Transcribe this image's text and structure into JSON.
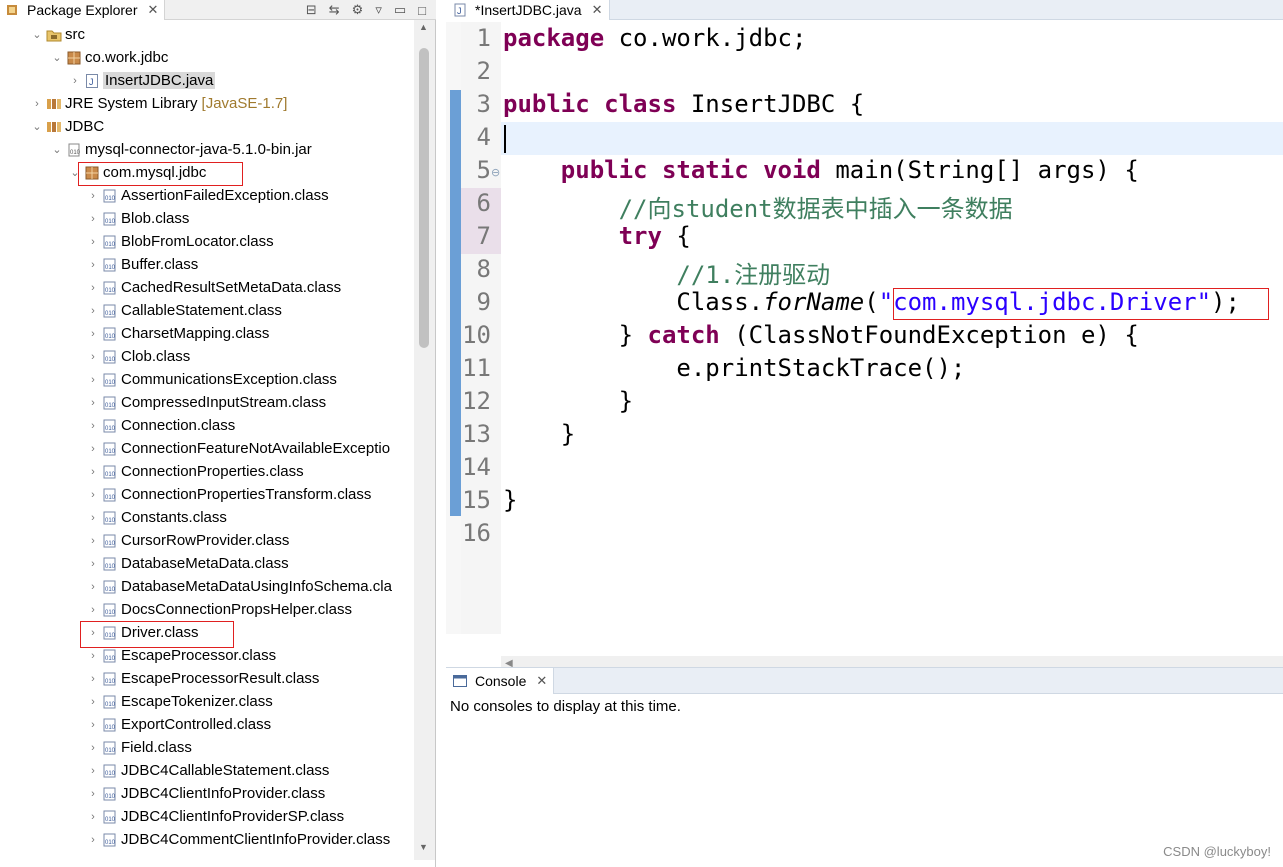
{
  "package_explorer": {
    "tab_label": "Package Explorer",
    "tree": [
      {
        "label": "src",
        "icon": "source-folder-icon",
        "arrow": "expanded"
      },
      {
        "label": "co.work.jdbc",
        "icon": "package-icon",
        "arrow": "expanded"
      },
      {
        "label": "InsertJDBC.java",
        "icon": "java-file-icon",
        "arrow": "collapsed"
      },
      {
        "label": "JRE System Library",
        "suffix": "[JavaSE-1.7]",
        "icon": "library-icon",
        "arrow": "collapsed"
      },
      {
        "label": "JDBC",
        "icon": "library-icon",
        "arrow": "expanded"
      },
      {
        "label": "mysql-connector-java-5.1.0-bin.jar",
        "icon": "jar-icon",
        "arrow": "expanded"
      },
      {
        "label": "com.mysql.jdbc",
        "icon": "package-icon",
        "arrow": "expanded"
      },
      {
        "label": "AssertionFailedException.class",
        "icon": "class-file-icon",
        "arrow": "collapsed"
      },
      {
        "label": "Blob.class",
        "icon": "class-file-icon",
        "arrow": "collapsed"
      },
      {
        "label": "BlobFromLocator.class",
        "icon": "class-file-icon",
        "arrow": "collapsed"
      },
      {
        "label": "Buffer.class",
        "icon": "class-file-icon",
        "arrow": "collapsed"
      },
      {
        "label": "CachedResultSetMetaData.class",
        "icon": "class-file-icon",
        "arrow": "collapsed"
      },
      {
        "label": "CallableStatement.class",
        "icon": "class-file-icon",
        "arrow": "collapsed"
      },
      {
        "label": "CharsetMapping.class",
        "icon": "class-file-icon",
        "arrow": "collapsed"
      },
      {
        "label": "Clob.class",
        "icon": "class-file-icon",
        "arrow": "collapsed"
      },
      {
        "label": "CommunicationsException.class",
        "icon": "class-file-icon",
        "arrow": "collapsed"
      },
      {
        "label": "CompressedInputStream.class",
        "icon": "class-file-icon",
        "arrow": "collapsed"
      },
      {
        "label": "Connection.class",
        "icon": "class-file-icon",
        "arrow": "collapsed"
      },
      {
        "label": "ConnectionFeatureNotAvailableExceptio",
        "icon": "class-file-icon",
        "arrow": "collapsed"
      },
      {
        "label": "ConnectionProperties.class",
        "icon": "class-file-icon",
        "arrow": "collapsed"
      },
      {
        "label": "ConnectionPropertiesTransform.class",
        "icon": "class-file-icon",
        "arrow": "collapsed"
      },
      {
        "label": "Constants.class",
        "icon": "class-file-icon",
        "arrow": "collapsed"
      },
      {
        "label": "CursorRowProvider.class",
        "icon": "class-file-icon",
        "arrow": "collapsed"
      },
      {
        "label": "DatabaseMetaData.class",
        "icon": "class-file-icon",
        "arrow": "collapsed"
      },
      {
        "label": "DatabaseMetaDataUsingInfoSchema.cla",
        "icon": "class-file-icon",
        "arrow": "collapsed"
      },
      {
        "label": "DocsConnectionPropsHelper.class",
        "icon": "class-file-icon",
        "arrow": "collapsed"
      },
      {
        "label": "Driver.class",
        "icon": "class-file-icon",
        "arrow": "collapsed"
      },
      {
        "label": "EscapeProcessor.class",
        "icon": "class-file-icon",
        "arrow": "collapsed"
      },
      {
        "label": "EscapeProcessorResult.class",
        "icon": "class-file-icon",
        "arrow": "collapsed"
      },
      {
        "label": "EscapeTokenizer.class",
        "icon": "class-file-icon",
        "arrow": "collapsed"
      },
      {
        "label": "ExportControlled.class",
        "icon": "class-file-icon",
        "arrow": "collapsed"
      },
      {
        "label": "Field.class",
        "icon": "class-file-icon",
        "arrow": "collapsed"
      },
      {
        "label": "JDBC4CallableStatement.class",
        "icon": "class-file-icon",
        "arrow": "collapsed"
      },
      {
        "label": "JDBC4ClientInfoProvider.class",
        "icon": "class-file-icon",
        "arrow": "collapsed"
      },
      {
        "label": "JDBC4ClientInfoProviderSP.class",
        "icon": "class-file-icon",
        "arrow": "collapsed"
      },
      {
        "label": "JDBC4CommentClientInfoProvider.class",
        "icon": "class-file-icon",
        "arrow": "collapsed"
      }
    ]
  },
  "editor": {
    "tab_label": "*InsertJDBC.java",
    "line_numbers": [
      "1",
      "2",
      "3",
      "4",
      "5",
      "6",
      "7",
      "8",
      "9",
      "10",
      "11",
      "12",
      "13",
      "14",
      "15",
      "16"
    ],
    "code": {
      "l1_kw": "package",
      "l1_rest": " co.work.jdbc;",
      "l3_kw": "public class",
      "l3_rest": " InsertJDBC {",
      "l5_indent": "    ",
      "l5_kw": "public static void",
      "l5_rest": " main(String[] args) {",
      "l6": "        //向student数据表中插入一条数据",
      "l7_indent": "        ",
      "l7_kw": "try",
      "l7_rest": " {",
      "l8": "            //1.注册驱动",
      "l9_pre": "            Class.",
      "l9_method": "forName",
      "l9_open": "(",
      "l9_str": "\"com.mysql.jdbc.Driver\"",
      "l9_close": ");",
      "l10_pre": "        } ",
      "l10_kw": "catch",
      "l10_rest": " (ClassNotFoundException e) {",
      "l11": "            e.printStackTrace();",
      "l12": "        }",
      "l13": "    }",
      "l15": "}"
    }
  },
  "console": {
    "tab_label": "Console",
    "message": "No consoles to display at this time."
  },
  "watermark": "CSDN @luckyboy!",
  "colors": {
    "keyword": "#7f0055",
    "comment": "#3f7f5f",
    "string": "#2a00ff",
    "highlight_box": "#e02020"
  }
}
